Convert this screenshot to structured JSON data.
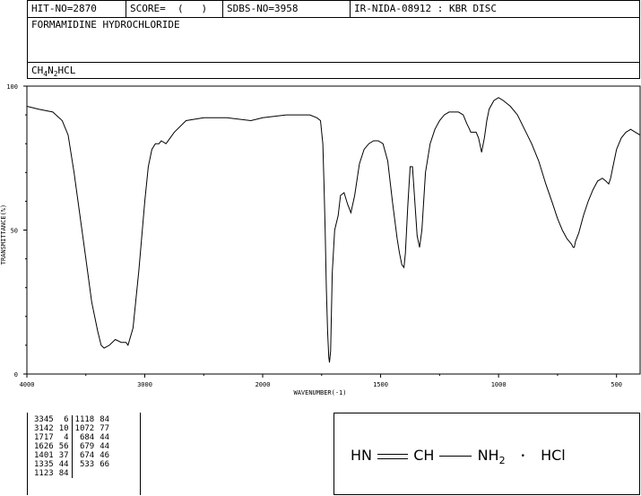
{
  "header": {
    "hit_no": "HIT-NO=2870",
    "score": "SCORE=  (   )",
    "sdbs_no": "SDBS-NO=3958",
    "ir_id": "IR-NIDA-08912 : KBR DISC"
  },
  "compound_name": "FORMAMIDINE HYDROCHLORIDE",
  "formula": {
    "p1": "CH",
    "s1": "4",
    "p2": "N",
    "s2": "2",
    "p3": "",
    "p4": "HCL"
  },
  "chart_data": {
    "type": "line",
    "title": "",
    "xlabel": "WAVENUMBER(-1)",
    "ylabel": "TRANSMITTANCE(%)",
    "xlim": [
      4000,
      400
    ],
    "ylim": [
      0,
      100
    ],
    "x_ticks": [
      "4000",
      "3000",
      "2000",
      "1500",
      "1000",
      "500"
    ],
    "y_ticks": [
      "100",
      "50",
      "0"
    ],
    "grid": false,
    "series": [
      {
        "name": "",
        "x": [
          4000,
          3900,
          3780,
          3700,
          3650,
          3600,
          3550,
          3500,
          3450,
          3400,
          3370,
          3345,
          3300,
          3250,
          3200,
          3160,
          3142,
          3100,
          3050,
          3000,
          2970,
          2940,
          2910,
          2880,
          2860,
          2820,
          2750,
          2650,
          2500,
          2300,
          2100,
          2000,
          1900,
          1850,
          1800,
          1770,
          1755,
          1745,
          1740,
          1735,
          1730,
          1725,
          1720,
          1717,
          1712,
          1705,
          1695,
          1680,
          1670,
          1655,
          1640,
          1626,
          1610,
          1590,
          1570,
          1550,
          1530,
          1510,
          1490,
          1470,
          1450,
          1430,
          1420,
          1410,
          1401,
          1395,
          1385,
          1375,
          1365,
          1355,
          1345,
          1335,
          1325,
          1310,
          1290,
          1270,
          1250,
          1230,
          1210,
          1190,
          1170,
          1150,
          1135,
          1123,
          1118,
          1110,
          1095,
          1085,
          1072,
          1060,
          1050,
          1040,
          1020,
          1000,
          980,
          950,
          920,
          890,
          860,
          830,
          800,
          770,
          750,
          730,
          710,
          700,
          690,
          684,
          679,
          674,
          660,
          640,
          620,
          600,
          580,
          560,
          545,
          533,
          525,
          515,
          500,
          480,
          460,
          440,
          420,
          400
        ],
        "y": [
          93,
          92,
          91,
          88,
          83,
          70,
          55,
          40,
          25,
          15,
          10,
          9,
          10,
          12,
          11,
          11,
          10,
          16,
          36,
          60,
          72,
          78,
          80,
          80,
          81,
          80,
          84,
          88,
          89,
          89,
          88,
          89,
          90,
          90,
          90,
          89,
          88,
          80,
          66,
          50,
          30,
          15,
          6,
          4,
          8,
          35,
          50,
          55,
          62,
          63,
          59,
          56,
          62,
          73,
          78,
          80,
          81,
          81,
          80,
          74,
          60,
          47,
          42,
          38,
          37,
          42,
          58,
          72,
          72,
          60,
          48,
          44,
          50,
          70,
          80,
          85,
          88,
          90,
          91,
          91,
          91,
          90,
          87,
          85,
          84,
          84,
          84,
          82,
          77,
          82,
          88,
          92,
          95,
          96,
          95,
          93,
          90,
          85,
          80,
          74,
          66,
          59,
          54,
          50,
          47,
          46,
          45,
          44,
          44,
          46,
          49,
          55,
          60,
          64,
          67,
          68,
          67,
          66,
          68,
          72,
          78,
          82,
          84,
          85,
          84,
          83
        ]
      }
    ]
  },
  "peak_table": {
    "rows": [
      {
        "w1": "3345",
        "t1": "6",
        "w2": "1118",
        "t2": "84"
      },
      {
        "w1": "3142",
        "t1": "10",
        "w2": "1072",
        "t2": "77"
      },
      {
        "w1": "1717",
        "t1": "4",
        "w2": "684",
        "t2": "44"
      },
      {
        "w1": "1626",
        "t1": "56",
        "w2": "679",
        "t2": "44"
      },
      {
        "w1": "1401",
        "t1": "37",
        "w2": "674",
        "t2": "46"
      },
      {
        "w1": "1335",
        "t1": "44",
        "w2": "533",
        "t2": "66"
      },
      {
        "w1": "1123",
        "t1": "84",
        "w2": "",
        "t2": ""
      }
    ]
  },
  "structure": {
    "hn": "HN",
    "ch": "CH",
    "nh": "NH",
    "sub2": "2",
    "dot": "•",
    "hcl": "HCl"
  }
}
